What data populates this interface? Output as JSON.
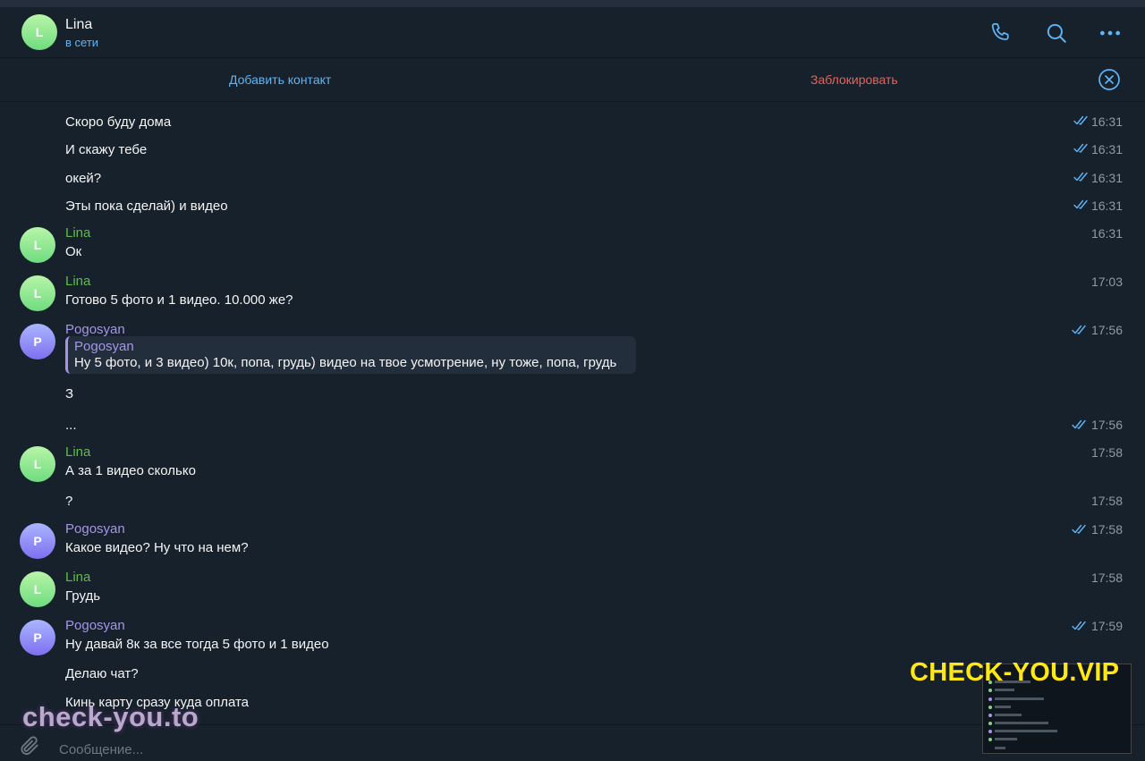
{
  "header": {
    "avatar_letter": "L",
    "name": "Lina",
    "status": "в сети",
    "icons": [
      "phone-icon",
      "search-icon",
      "more-icon"
    ]
  },
  "actionbar": {
    "add_contact": "Добавить контакт",
    "block": "Заблокировать",
    "close_icon": "close-circle-icon"
  },
  "messages": [
    {
      "text": "Скоро буду дома",
      "time": "16:31",
      "read": true
    },
    {
      "text": "И скажу тебе",
      "time": "16:31",
      "read": true
    },
    {
      "text": "окей?",
      "time": "16:31",
      "read": true
    },
    {
      "text": "Эты пока сделай) и видео",
      "time": "16:31",
      "read": true
    },
    {
      "author": "Lina",
      "avatar_letter": "L",
      "text": "Ок",
      "time": "16:31"
    },
    {
      "author": "Lina",
      "avatar_letter": "L",
      "text": "Готово 5 фото и 1 видео. 10.000 же?",
      "time": "17:03"
    },
    {
      "author": "Pogosyan",
      "avatar_letter": "P",
      "time": "17:56",
      "read": true,
      "reply": {
        "author": "Pogosyan",
        "text": "Ну 5 фото, и 3 видео) 10к, попа, грудь) видео на твое усмотрение, ну тоже, попа, грудь"
      },
      "text": "З"
    },
    {
      "text": "...",
      "time": "17:56",
      "read": true
    },
    {
      "author": "Lina",
      "avatar_letter": "L",
      "text": "А за 1 видео сколько",
      "time": "17:58"
    },
    {
      "text": "?",
      "time": "17:58"
    },
    {
      "author": "Pogosyan",
      "avatar_letter": "P",
      "text": "Какое видео? Ну что на нем?",
      "time": "17:58",
      "read": true
    },
    {
      "author": "Lina",
      "avatar_letter": "L",
      "text": "Грудь",
      "time": "17:58"
    },
    {
      "author": "Pogosyan",
      "avatar_letter": "P",
      "text": "Ну давай 8к за все тогда 5 фото и 1 видео",
      "time": "17:59",
      "read": true
    },
    {
      "text": "Делаю чат?"
    },
    {
      "text": "Кинь карту сразу куда оплата"
    }
  ],
  "composer": {
    "placeholder": "Сообщение...",
    "attach_icon": "paperclip-icon"
  },
  "watermarks": {
    "left": "check-you.to",
    "right": "CHECK-YOU.VIP"
  },
  "colors": {
    "background": "#17212b",
    "accent": "#5eb5f7",
    "danger": "#e5635a",
    "lina": "#5fba4c",
    "pogosyan": "#a695e7",
    "watermark_yellow": "#ffe815"
  }
}
